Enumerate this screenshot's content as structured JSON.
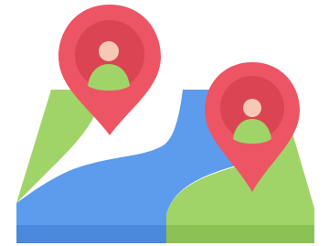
{
  "illustration": {
    "subject": "location-pins-on-map-icon",
    "colors": {
      "land": "#a0d468",
      "land_edge": "#8cc153",
      "water": "#5d9cec",
      "water_edge": "#4a89dc",
      "pin": "#ed5565",
      "pin_inner": "#da4453",
      "person_head": "#f5c9b5",
      "person_body": "#a0d468",
      "background": "#ffffff"
    },
    "pins": [
      {
        "name": "left-pin",
        "avatar": "person-avatar-icon"
      },
      {
        "name": "right-pin",
        "avatar": "person-avatar-icon"
      }
    ]
  }
}
